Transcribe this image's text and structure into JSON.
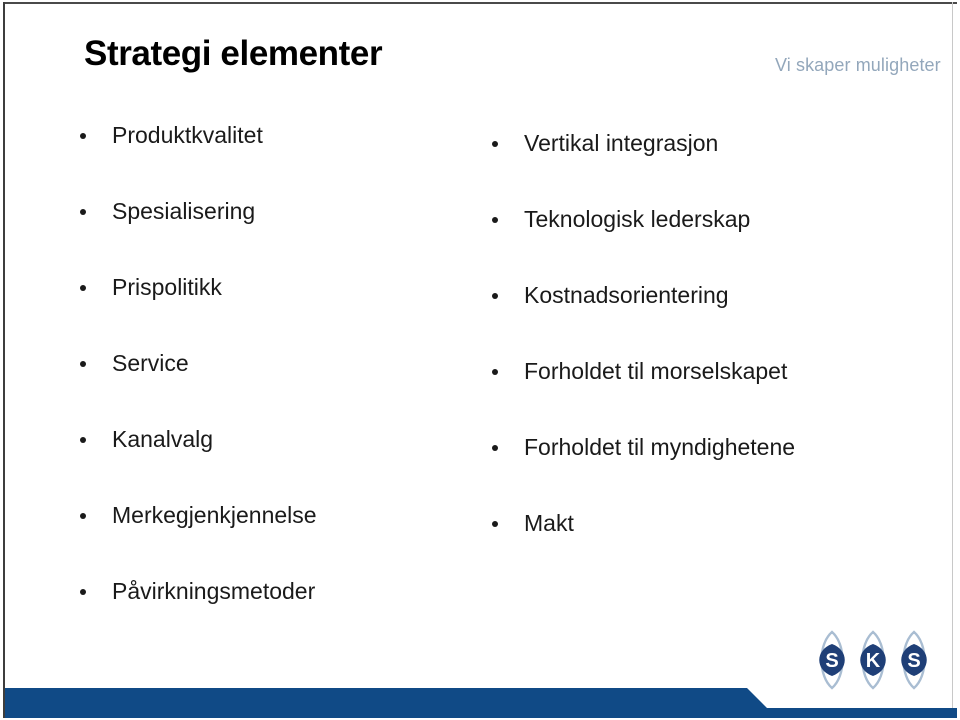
{
  "slide": {
    "title": "Strategi elementer",
    "tagline": "Vi skaper muligheter",
    "colors": {
      "footer_blue": "#104a86",
      "logo_dark_blue": "#1f3f77",
      "logo_light_blue": "#a9bdd2",
      "tagline_gray_blue": "#93a7bb",
      "text_black": "#1a1a1a",
      "background": "#ffffff"
    },
    "columns": {
      "left": [
        "Produktkvalitet",
        "Spesialisering",
        "Prispolitikk",
        "Service",
        "Kanalvalg",
        "Merkegjenkjennelse",
        "Påvirkningsmetoder"
      ],
      "right": [
        "Vertikal integrasjon",
        "Teknologisk lederskap",
        "Kostnadsorientering",
        "Forholdet til morselskapet",
        "Forholdet til myndighetene",
        "Makt"
      ]
    },
    "logo": {
      "name": "sks-logo",
      "letters": [
        "S",
        "K",
        "S"
      ]
    }
  }
}
